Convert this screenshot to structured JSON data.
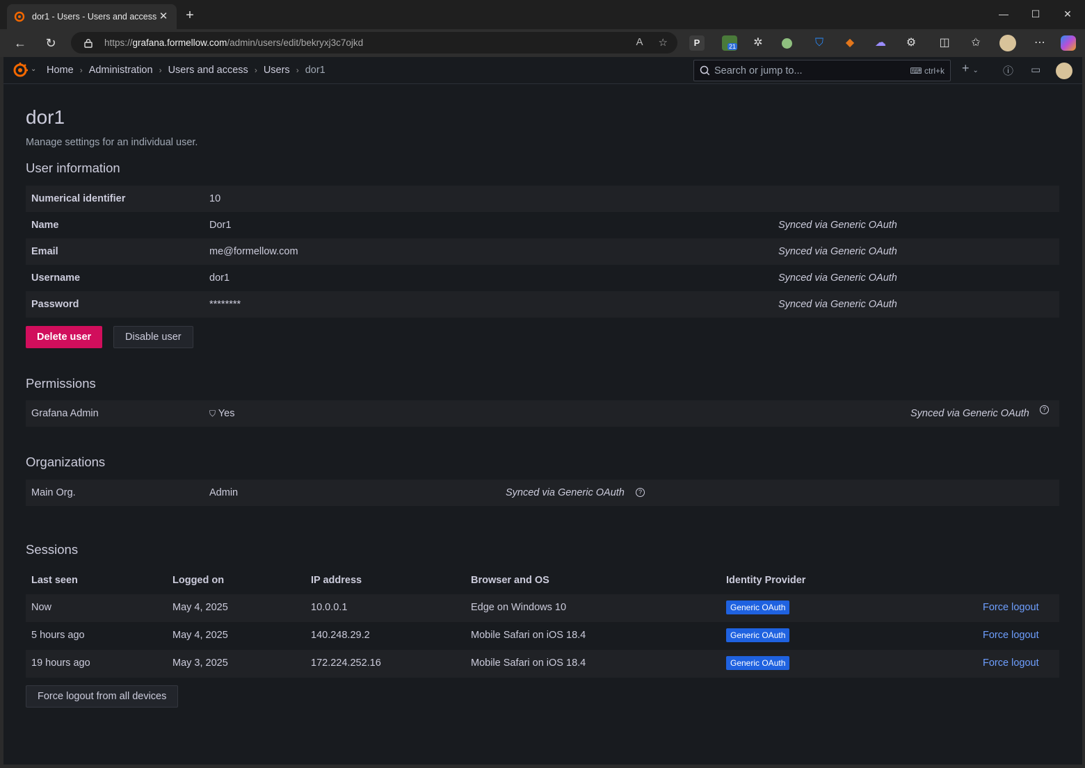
{
  "browser": {
    "tab_title": "dor1 - Users - Users and access -",
    "url_prefix": "https://",
    "url_host": "grafana.formellow.com",
    "url_path": "/admin/users/edit/bekryxj3c7ojkd",
    "ext_badge_count": "21"
  },
  "topnav": {
    "breadcrumbs": [
      "Home",
      "Administration",
      "Users and access",
      "Users",
      "dor1"
    ],
    "search_placeholder": "Search or jump to...",
    "search_shortcut": "ctrl+k"
  },
  "page": {
    "title": "dor1",
    "subtitle": "Manage settings for an individual user."
  },
  "user_info": {
    "heading": "User information",
    "rows": [
      {
        "label": "Numerical identifier",
        "value": "10",
        "sync": ""
      },
      {
        "label": "Name",
        "value": "Dor1",
        "sync": "Synced via Generic OAuth"
      },
      {
        "label": "Email",
        "value": "me@formellow.com",
        "sync": "Synced via Generic OAuth"
      },
      {
        "label": "Username",
        "value": "dor1",
        "sync": "Synced via Generic OAuth"
      },
      {
        "label": "Password",
        "value": "********",
        "sync": "Synced via Generic OAuth"
      }
    ],
    "delete_label": "Delete user",
    "disable_label": "Disable user"
  },
  "permissions": {
    "heading": "Permissions",
    "label": "Grafana Admin",
    "value": "Yes",
    "sync": "Synced via Generic OAuth"
  },
  "organizations": {
    "heading": "Organizations",
    "org": "Main Org.",
    "role": "Admin",
    "sync": "Synced via Generic OAuth"
  },
  "sessions": {
    "heading": "Sessions",
    "columns": [
      "Last seen",
      "Logged on",
      "IP address",
      "Browser and OS",
      "Identity Provider"
    ],
    "rows": [
      {
        "last_seen": "Now",
        "logged_on": "May 4, 2025",
        "ip": "10.0.0.1",
        "browser": "Edge on Windows 10",
        "provider": "Generic OAuth",
        "action": "Force logout"
      },
      {
        "last_seen": "5 hours ago",
        "logged_on": "May 4, 2025",
        "ip": "140.248.29.2",
        "browser": "Mobile Safari on iOS 18.4",
        "provider": "Generic OAuth",
        "action": "Force logout"
      },
      {
        "last_seen": "19 hours ago",
        "logged_on": "May 3, 2025",
        "ip": "172.224.252.16",
        "browser": "Mobile Safari on iOS 18.4",
        "provider": "Generic OAuth",
        "action": "Force logout"
      }
    ],
    "logout_all_label": "Force logout from all devices"
  },
  "colors": {
    "danger": "#d10e5c",
    "link": "#6e9fff",
    "badge": "#1f62e0",
    "background": "#181b1f"
  }
}
